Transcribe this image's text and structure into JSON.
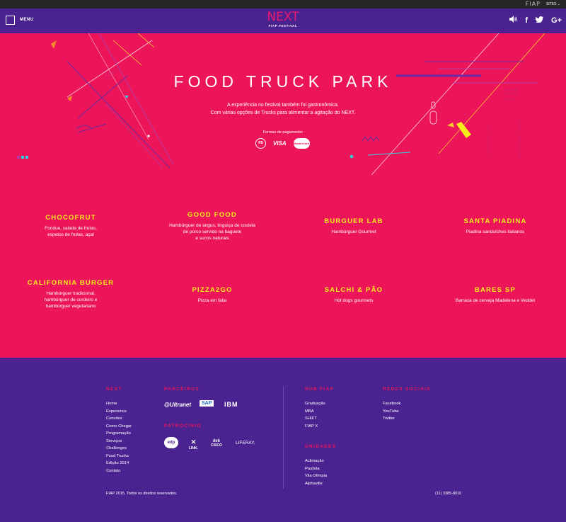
{
  "topbar": {
    "brand": "FIAP",
    "sites_label": "SITES ⌄"
  },
  "header": {
    "menu_label": "MENU",
    "logo_main": "NEXT",
    "logo_sub": "FIAP FESTIVAL",
    "icons": [
      "speaker-icon",
      "facebook-icon",
      "twitter-icon",
      "google-plus-icon"
    ],
    "icon_glyphs": {
      "facebook": "f",
      "google": "G+"
    }
  },
  "hero": {
    "title": "FOOD TRUCK PARK",
    "description_line1": "A experiência no festival também foi gastronômica.",
    "description_line2": "Com várias opções de Trucks para alimentar a agitação do NEXT.",
    "payment_label": "Formas de pagamento:",
    "payment_rs": "R$",
    "payment_visa": "VISA",
    "payment_mastercard": "MasterCard"
  },
  "trucks": [
    {
      "name": "CHOCOFRUT",
      "desc": "Fondue, salada de frutas,\nespetos de frutas, açaí"
    },
    {
      "name": "GOOD FOOD",
      "desc": "Hambúrguer de angus, linguiça de costela\nde porco servido na baguete\ne sucos naturais"
    },
    {
      "name": "BURGUER LAB",
      "desc": "Hambúrguer Gourmet"
    },
    {
      "name": "SANTA PIADINA",
      "desc": "Piadina sanduíches italianos"
    },
    {
      "name": "CALIFORNIA BURGER",
      "desc": "Hambúrguer tradicional,\nhambúrguer de cordeiro e\nhambúrguer vegetariano"
    },
    {
      "name": "PIZZA2GO",
      "desc": "Pizza em fatia"
    },
    {
      "name": "SALCHI & PÃO",
      "desc": "Hot dogs gourmets"
    },
    {
      "name": "BARES SP",
      "desc": "Barraca de cerveja Madalena e Veddet"
    }
  ],
  "footer": {
    "next_heading": "NEXT",
    "next_links": [
      "Home",
      "Experience",
      "Convites",
      "Como Chegar",
      "Programação",
      "Serviços",
      "Challenges",
      "Food Trucks",
      "Edição 2014",
      "Contato"
    ],
    "parceiros_heading": "PARCEIROS",
    "parceiros": [
      "@Ultranet",
      "SAP",
      "IBM"
    ],
    "patrocinio_heading": "PATROCÍNIO",
    "patrocinio": [
      "edp",
      "LINK.",
      "CISCO",
      "LIFERAY."
    ],
    "hub_heading": "HUB FIAP",
    "hub_links": [
      "Graduação",
      "MBA",
      "SHIFT",
      "FIAP X"
    ],
    "unidades_heading": "UNIDADES",
    "unidades_links": [
      "Aclimação",
      "Paulista",
      "Vila Olímpia",
      "Alphaville"
    ],
    "redes_heading": "REDES SOCIAIS",
    "redes_links": [
      "Facebook",
      "YouTube",
      "Twitter"
    ],
    "copyright": "FIAP 2015. Todos os direitos reservados.",
    "phone": "(11) 3385-8010"
  },
  "colors": {
    "pink": "#ed1559",
    "purple": "#4a2390",
    "yellow": "#f6ec1d",
    "cyan": "#2fd3e6"
  }
}
